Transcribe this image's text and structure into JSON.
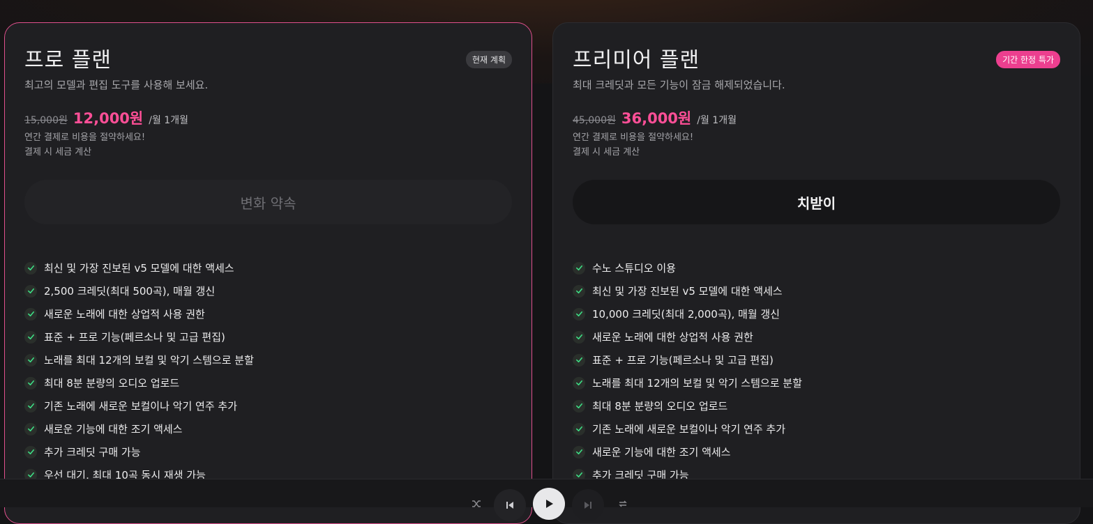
{
  "plans": [
    {
      "title": "프로 플랜",
      "badge": "현재 계획",
      "subtitle": "최고의 모델과 편집 도구를 사용해 보세요.",
      "old_price": "15,000원",
      "new_price": "12,000원",
      "period": "/월 1개월",
      "note1": "연간 결제로 비용을 절약하세요!",
      "note2": "결제 시 세금 계산",
      "cta": "변화 약속",
      "features": [
        "최신 및 가장 진보된 v5 모델에 대한 액세스",
        "2,500 크레딧(최대 500곡), 매월 갱신",
        "새로운 노래에 대한 상업적 사용 권한",
        "표준 + 프로 기능(페르소나 및 고급 편집)",
        "노래를 최대 12개의 보컬 및 악기 스템으로 분할",
        "최대 8분 분량의 오디오 업로드",
        "기존 노래에 새로운 보컬이나 악기 연주 추가",
        "새로운 기능에 대한 조기 액세스",
        "추가 크레딧 구매 가능",
        "우선 대기, 최대 10곡 동시 재생 가능"
      ]
    },
    {
      "title": "프리미어 플랜",
      "badge": "기간 한정 특가",
      "subtitle": "최대 크레딧과 모든 기능이 잠금 해제되었습니다.",
      "old_price": "45,000원",
      "new_price": "36,000원",
      "period": "/월 1개월",
      "note1": "연간 결제로 비용을 절약하세요!",
      "note2": "결제 시 세금 계산",
      "cta": "치받이",
      "features": [
        "수노 스튜디오 이용",
        "최신 및 가장 진보된 v5 모델에 대한 액세스",
        "10,000 크레딧(최대 2,000곡), 매월 갱신",
        "새로운 노래에 대한 상업적 사용 권한",
        "표준 + 프로 기능(페르소나 및 고급 편집)",
        "노래를 최대 12개의 보컬 및 악기 스템으로 분할",
        "최대 8분 분량의 오디오 업로드",
        "기존 노래에 새로운 보컬이나 악기 연주 추가",
        "새로운 기능에 대한 조기 액세스",
        "추가 크레딧 구매 가능"
      ]
    }
  ],
  "player": {
    "icons": [
      "shuffle-icon",
      "skip-back-icon",
      "play-icon",
      "skip-forward-icon",
      "repeat-icon"
    ]
  },
  "colors": {
    "accent": "#ff4f97",
    "badge_limited": "#ec3f8f",
    "check": "#3ddc84"
  }
}
